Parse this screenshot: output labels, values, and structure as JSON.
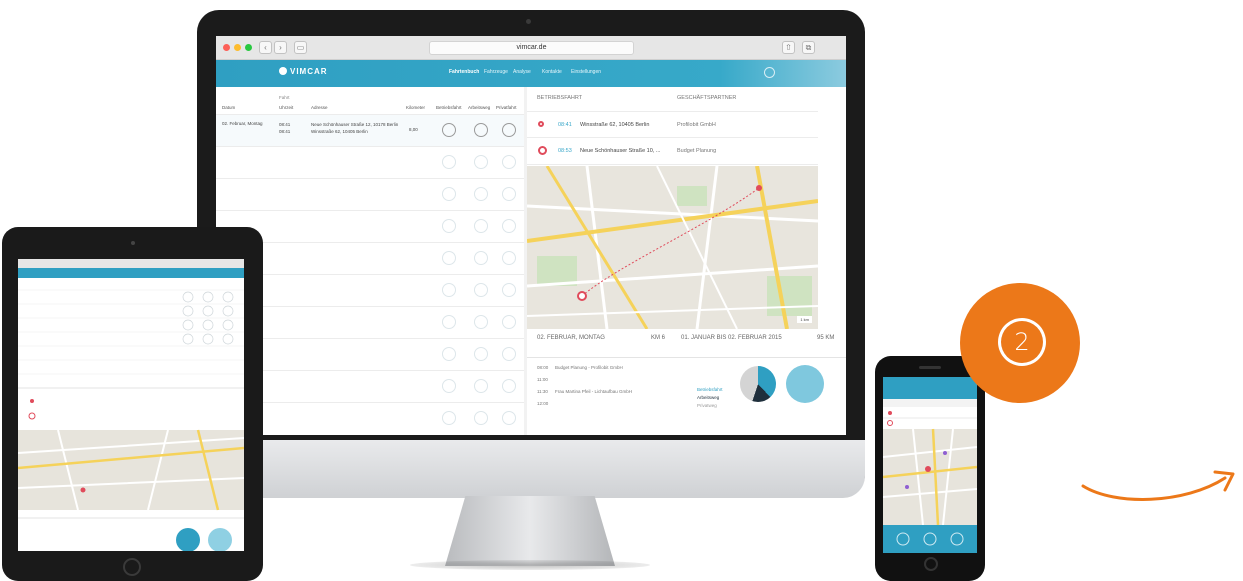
{
  "colors": {
    "brand": "#2f9fc2",
    "accent": "#ec7819",
    "pin": "#e04b5b"
  },
  "browser": {
    "url": "vimcar.de"
  },
  "app": {
    "logo": "VIMCAR",
    "nav": [
      "Fahrtenbuch",
      "Fahrzeuge",
      "Analyse",
      "Kontakte",
      "Einstellungen"
    ],
    "nav_active": "Fahrtenbuch"
  },
  "trip_list": {
    "subheader": "Fahrt",
    "columns": [
      "Datum",
      "Uhrzeit",
      "Adresse",
      "Kilometer",
      "Betriebsfahrt",
      "Arbeitsweg",
      "Privatfahrt"
    ],
    "rows": [
      {
        "date": "02. Februar, Montag",
        "times": [
          "08:41",
          "08:41"
        ],
        "address": [
          "Neue Schönhauser Straße 12, 10178 Berlin",
          "Winsstraße 62, 10405 Berlin"
        ],
        "km": "8,00"
      }
    ]
  },
  "detail": {
    "left_header": "BETRIEBSFAHRT",
    "right_header": "GESCHÄFTSPARTNER",
    "stops": [
      {
        "time": "08:41",
        "address": "Winsstraße 62, 10405 Berlin",
        "partner": "Profilobit GmbH"
      },
      {
        "time": "08:53",
        "address": "Neue Schönhauser Straße 10, ...",
        "partner": "Budget Planung"
      }
    ],
    "day_summary": {
      "title": "02. FEBRUAR, MONTAG",
      "km": "KM 6"
    },
    "range_summary": {
      "title": "01. JANUAR BIS 02. FEBRUAR 2015",
      "km": "95 KM"
    },
    "entries": [
      {
        "time": "08:00",
        "text": "Budget Planung - Profilobit GmbH"
      },
      {
        "time": "11:00",
        "text": ""
      },
      {
        "time": "11:30",
        "text": "Frau Martina Pfeil - Lichtaufbau GmbH"
      },
      {
        "time": "12:00",
        "text": ""
      }
    ],
    "legend": [
      "Betriebsfahrt",
      "Arbeitsweg",
      "Privatweg"
    ],
    "map_scale": "1 km"
  },
  "badge": {
    "step": "2"
  }
}
